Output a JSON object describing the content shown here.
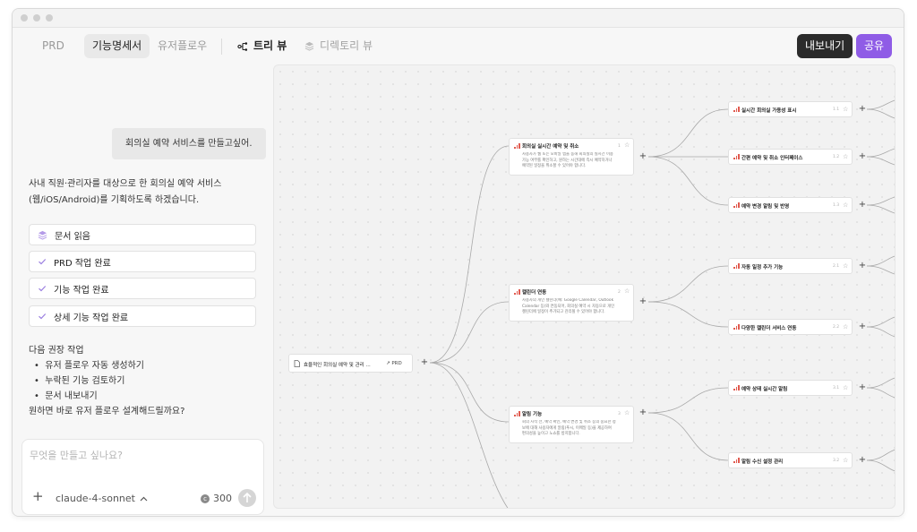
{
  "tabs": [
    {
      "label": "PRD",
      "active": false
    },
    {
      "label": "기능명세서",
      "active": true
    },
    {
      "label": "유저플로우",
      "active": false
    }
  ],
  "views": {
    "tree": {
      "label": "트리 뷰",
      "icon": "tree-icon",
      "active": true
    },
    "directory": {
      "label": "디렉토리 뷰",
      "icon": "layers-icon",
      "active": false
    }
  },
  "actions": {
    "export_label": "내보내기",
    "share_label": "공유",
    "export_color": "#2b2b2b",
    "share_color": "#8f5ce6"
  },
  "chat": {
    "user_message": "회의실 예약 서비스를 만들고싶어.",
    "assistant_intro": "사내 직원·관리자를 대상으로 한 회의실 예약 서비스(웹/iOS/Android)를 기획하도록 하겠습니다.",
    "steps": [
      {
        "label": "문서 읽음",
        "icon": "layers-icon"
      },
      {
        "label": "PRD 작업 완료",
        "icon": "check-icon"
      },
      {
        "label": "기능 작업 완료",
        "icon": "check-icon"
      },
      {
        "label": "상세 기능 작업 완료",
        "icon": "check-icon"
      }
    ],
    "recommend_title": "다음 권장 작업",
    "recommendations": [
      "유저 플로우 자동 생성하기",
      "누락된 기능 검토하기",
      "문서 내보내기"
    ],
    "followup": "원하면 바로 유저 플로우 설계해드릴까요?",
    "input_placeholder": "무엇을 만들고 싶나요?",
    "model": "claude-4-sonnet",
    "credits": "300"
  },
  "tree": {
    "root": {
      "title": "효율적인 회의실 예약 및 관리 ...",
      "badge": "PRD"
    },
    "features": [
      {
        "title": "회의실 실시간 예약 및 취소",
        "num": "1",
        "desc": [
          "사용자가 웹 또는 모바일 앱을 통해 회의실의 실시간 이용",
          "가능 여부를 확인하고, 원하는 시간대에 즉시 예약하거나",
          "예약된 일정을 취소할 수 있어야 합니다."
        ]
      },
      {
        "title": "캘린더 연동",
        "num": "2",
        "desc": [
          "사용자의 개인 캘린더(예: Google Calendar, Outlook",
          "Calendar 등)와 연동되어, 회의실 예약 시 자동으로 개인",
          "캘린더에 일정이 추가되고 관리될 수 있어야 합니다."
        ]
      },
      {
        "title": "알림 기능",
        "num": "3",
        "desc": [
          "회의 시작 전, 예약 확인, 예약 변경 및 취소 등의 중요한 정",
          "보에 대해 사용자에게 알림(푸시, 이메일 등)을 제공하여",
          "편의성을 높이고 노쇼를 방지합니다."
        ]
      }
    ],
    "subfeatures": [
      {
        "title": "실시간 회의실 가용성 표시",
        "num": "1.1"
      },
      {
        "title": "간편 예약 및 취소 인터페이스",
        "num": "1.2"
      },
      {
        "title": "예약 변경 알림 및 반영",
        "num": "1.3"
      },
      {
        "title": "자동 일정 추가 기능",
        "num": "2.1"
      },
      {
        "title": "다양한 캘린더 서비스 연동",
        "num": "2.2"
      },
      {
        "title": "예약 상태 실시간 알림",
        "num": "3.1"
      },
      {
        "title": "알림 수신 설정 관리",
        "num": "3.2"
      }
    ]
  }
}
